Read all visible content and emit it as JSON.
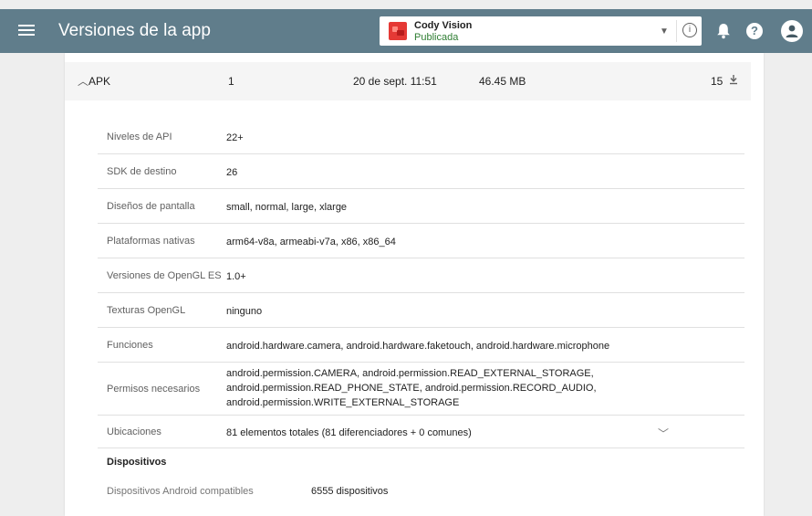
{
  "header": {
    "title": "Versiones de la app",
    "app_name": "Cody Vision",
    "app_status": "Publicada"
  },
  "apk": {
    "label": "APK",
    "version": "1",
    "date": "20 de sept. 11:51",
    "size": "46.45 MB",
    "count": "15"
  },
  "details": [
    {
      "label": "Niveles de API",
      "value": "22+"
    },
    {
      "label": "SDK de destino",
      "value": "26"
    },
    {
      "label": "Diseños de pantalla",
      "value": "small, normal, large, xlarge"
    },
    {
      "label": "Plataformas nativas",
      "value": "arm64-v8a, armeabi-v7a, x86, x86_64"
    },
    {
      "label": "Versiones de OpenGL ES",
      "value": "1.0+"
    },
    {
      "label": "Texturas OpenGL",
      "value": "ninguno"
    },
    {
      "label": "Funciones",
      "value": "android.hardware.camera, android.hardware.faketouch, android.hardware.microphone"
    },
    {
      "label": "Permisos necesarios",
      "value_lines": [
        "android.permission.CAMERA, android.permission.READ_EXTERNAL_STORAGE,",
        "android.permission.READ_PHONE_STATE, android.permission.RECORD_AUDIO,",
        "android.permission.WRITE_EXTERNAL_STORAGE"
      ]
    },
    {
      "label": "Ubicaciones",
      "value": "81 elementos totales (81 diferenciadores + 0 comunes)"
    }
  ],
  "devices": {
    "heading": "Dispositivos",
    "label": "Dispositivos Android compatibles",
    "value": "6555 dispositivos"
  },
  "icons": {
    "menu": "menu-icon",
    "dropdown": "caret-down-icon",
    "info": "info-icon",
    "bell": "bell-icon",
    "help": "help-icon",
    "avatar": "account-icon",
    "collapse": "chevron-up-icon",
    "download": "download-icon",
    "expand": "chevron-down-icon"
  },
  "colors": {
    "appbar": "#607d8b",
    "status_green": "#2e7d32",
    "app_icon_red": "#e53935"
  }
}
